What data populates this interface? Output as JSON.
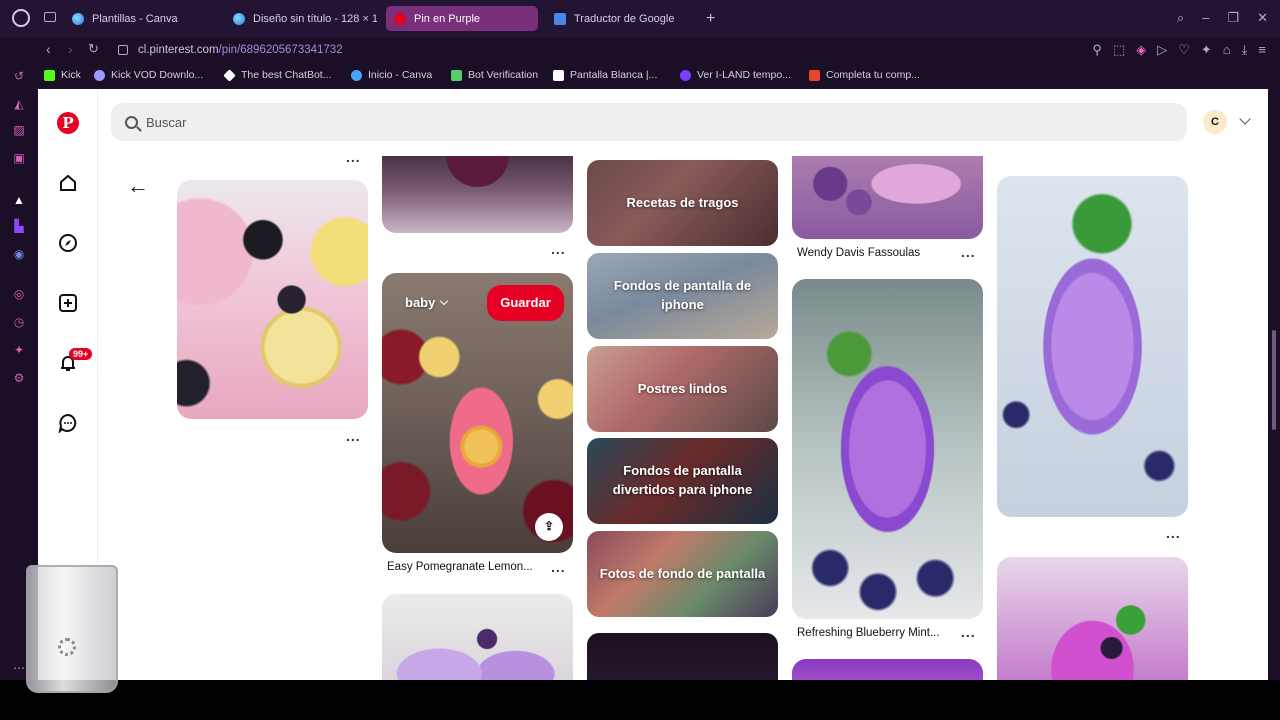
{
  "browser": {
    "tabs": [
      {
        "label": "Plantillas - Canva",
        "favicon": "canva-icon",
        "active": false
      },
      {
        "label": "Diseño sin título - 128 × 1",
        "favicon": "canva-icon",
        "active": false
      },
      {
        "label": "Pin en Purple",
        "favicon": "pinterest-icon",
        "active": true
      },
      {
        "label": "Traductor de Google",
        "favicon": "google-translate-icon",
        "active": false
      }
    ],
    "url": {
      "domain": "cl.pinterest.com",
      "path": "/pin/6896205673341732"
    },
    "bookmarks": [
      {
        "label": "Kick",
        "icon": "kick-icon",
        "color": "#53fc18"
      },
      {
        "label": "Kick VOD Downlo...",
        "icon": "kick-vod-icon",
        "color": "#9b9bff"
      },
      {
        "label": "The best ChatBot...",
        "icon": "chatbot-icon",
        "color": "#ffffff"
      },
      {
        "label": "Inicio - Canva",
        "icon": "canva-icon",
        "color": "#4aa3ff"
      },
      {
        "label": "Bot Verification",
        "icon": "shield-icon",
        "color": "#53d06a"
      },
      {
        "label": "Pantalla Blanca |...",
        "icon": "page-icon",
        "color": "#ffffff"
      },
      {
        "label": "Ver I-LAND tempo...",
        "icon": "play-icon",
        "color": "#7a3cff"
      },
      {
        "label": "Completa tu comp...",
        "icon": "mail-icon",
        "color": "#e8452c"
      }
    ]
  },
  "pinterest": {
    "search_placeholder": "Buscar",
    "avatar_initial": "C",
    "notification_count": "99+",
    "board_select_label": "baby",
    "save_label": "Guardar",
    "more_label": "...",
    "pins": {
      "pomegranate_caption": "Easy Pomegranate Lemon...",
      "wendy_caption": "Wendy Davis Fassoulas",
      "blueberry_caption": "Refreshing Blueberry Mint..."
    },
    "boards": [
      "Recetas de tragos",
      "Fondos de pantalla de iphone",
      "Postres lindos",
      "Fondos de pantalla divertidos para iphone",
      "Fotos de fondo de pantalla"
    ]
  },
  "colors": {
    "pinterest_red": "#e60023",
    "browser_bg": "#241433",
    "active_tab": "#7a2f7a"
  }
}
